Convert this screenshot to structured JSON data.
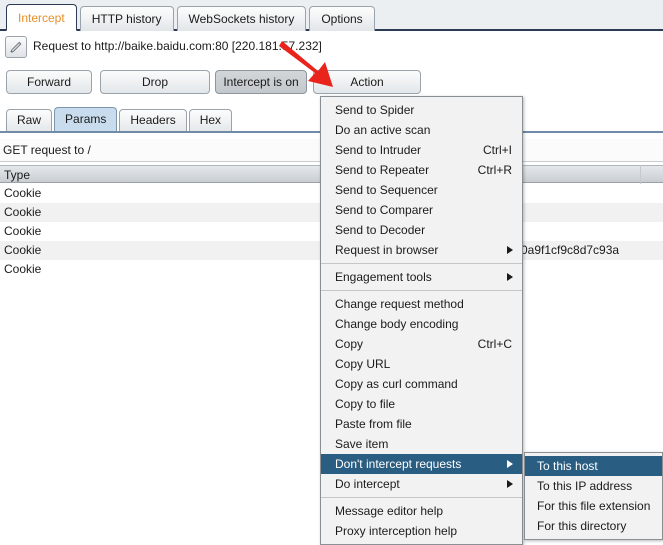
{
  "tabs": [
    {
      "label": "Intercept",
      "active": true
    },
    {
      "label": "HTTP history",
      "active": false
    },
    {
      "label": "WebSockets history",
      "active": false
    },
    {
      "label": "Options",
      "active": false
    }
  ],
  "request": {
    "edit_icon": "pencil-icon",
    "text": "Request to http://baike.baidu.com:80  [220.181.57.232]"
  },
  "buttons": {
    "forward": "Forward",
    "drop": "Drop",
    "intercept": "Intercept is on",
    "action": "Action"
  },
  "subtabs": [
    {
      "label": "Raw",
      "active": false
    },
    {
      "label": "Params",
      "active": true
    },
    {
      "label": "Headers",
      "active": false
    },
    {
      "label": "Hex",
      "active": false
    }
  ],
  "summary": "GET request to /",
  "table": {
    "columns": [
      "Type"
    ],
    "rows": [
      {
        "type": "Cookie",
        "value_fragment": ""
      },
      {
        "type": "Cookie",
        "value_fragment": ""
      },
      {
        "type": "Cookie",
        "value_fragment": ""
      },
      {
        "type": "Cookie",
        "value_fragment": "0a9f1cf9c8d7c93a"
      },
      {
        "type": "Cookie",
        "value_fragment": ""
      }
    ]
  },
  "context_menu": {
    "items": [
      {
        "label": "Send to Spider",
        "shortcut": "",
        "submenu": false,
        "selected": false
      },
      {
        "label": "Do an active scan",
        "shortcut": "",
        "submenu": false,
        "selected": false
      },
      {
        "label": "Send to Intruder",
        "shortcut": "Ctrl+I",
        "submenu": false,
        "selected": false
      },
      {
        "label": "Send to Repeater",
        "shortcut": "Ctrl+R",
        "submenu": false,
        "selected": false
      },
      {
        "label": "Send to Sequencer",
        "shortcut": "",
        "submenu": false,
        "selected": false
      },
      {
        "label": "Send to Comparer",
        "shortcut": "",
        "submenu": false,
        "selected": false
      },
      {
        "label": "Send to Decoder",
        "shortcut": "",
        "submenu": false,
        "selected": false
      },
      {
        "label": "Request in browser",
        "shortcut": "",
        "submenu": true,
        "selected": false
      },
      {
        "separator": true
      },
      {
        "label": "Engagement tools",
        "shortcut": "",
        "submenu": true,
        "selected": false
      },
      {
        "separator": true
      },
      {
        "label": "Change request method",
        "shortcut": "",
        "submenu": false,
        "selected": false
      },
      {
        "label": "Change body encoding",
        "shortcut": "",
        "submenu": false,
        "selected": false
      },
      {
        "label": "Copy",
        "shortcut": "Ctrl+C",
        "submenu": false,
        "selected": false
      },
      {
        "label": "Copy URL",
        "shortcut": "",
        "submenu": false,
        "selected": false
      },
      {
        "label": "Copy as curl command",
        "shortcut": "",
        "submenu": false,
        "selected": false
      },
      {
        "label": "Copy to file",
        "shortcut": "",
        "submenu": false,
        "selected": false
      },
      {
        "label": "Paste from file",
        "shortcut": "",
        "submenu": false,
        "selected": false
      },
      {
        "label": "Save item",
        "shortcut": "",
        "submenu": false,
        "selected": false
      },
      {
        "label": "Don't intercept requests",
        "shortcut": "",
        "submenu": true,
        "selected": true
      },
      {
        "label": "Do intercept",
        "shortcut": "",
        "submenu": true,
        "selected": false
      },
      {
        "separator": true
      },
      {
        "label": "Message editor help",
        "shortcut": "",
        "submenu": false,
        "selected": false
      },
      {
        "label": "Proxy interception help",
        "shortcut": "",
        "submenu": false,
        "selected": false
      }
    ]
  },
  "submenu": {
    "items": [
      {
        "label": "To this host",
        "selected": true
      },
      {
        "label": "To this IP address",
        "selected": false
      },
      {
        "label": "For this file extension",
        "selected": false
      },
      {
        "label": "For this directory",
        "selected": false
      }
    ]
  },
  "annotation": {
    "arrow_icon": "red-arrow-pointing-to-action-button",
    "color": "#e8241c"
  },
  "colors": {
    "accent_tab": "#e8902a",
    "menu_highlight": "#2a5d82",
    "tabstrip_border": "#2b3a55",
    "subtab_active": "#c9dced"
  }
}
